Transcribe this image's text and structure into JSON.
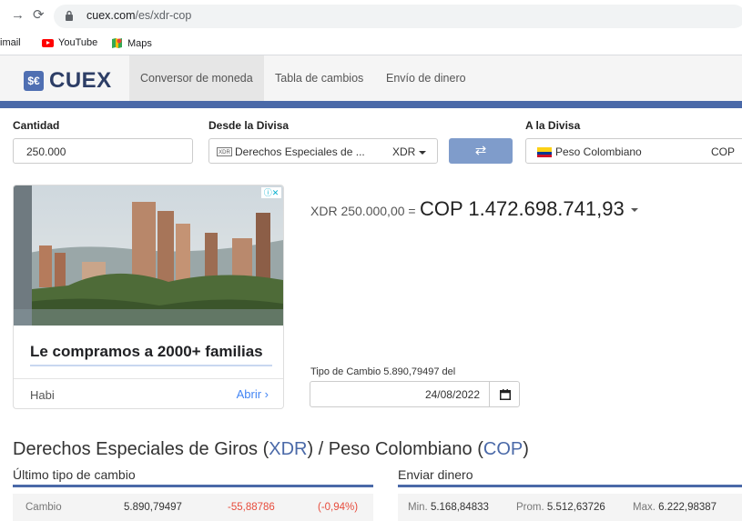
{
  "browser": {
    "url_host": "cuex.com",
    "url_path": "/es/xdr-cop",
    "bookmarks": [
      {
        "label": "imail"
      },
      {
        "label": "YouTube",
        "icon": "youtube-icon"
      },
      {
        "label": "Maps",
        "icon": "maps-icon"
      }
    ]
  },
  "site": {
    "logo_text": "CUEX",
    "logo_badge": "$€",
    "tabs": [
      "Conversor de moneda",
      "Tabla de cambios",
      "Envío de dinero"
    ]
  },
  "converter": {
    "amount_label": "Cantidad",
    "amount_value": "250.000",
    "from_label": "Desde la Divisa",
    "from_icon_text": "XDR",
    "from_name": "Derechos Especiales de ...",
    "from_code": "XDR",
    "swap_symbol": "⇄",
    "to_label": "A la Divisa",
    "to_name": "Peso Colombiano",
    "to_code": "COP"
  },
  "ad": {
    "adchoices": "ⓘ✕",
    "headline": "Le compramos a 2000+ familias",
    "brand": "Habi",
    "cta": "Abrir ›"
  },
  "result": {
    "from_text": "XDR 250.000,00 =",
    "to_text": "COP 1.472.698.741,93"
  },
  "rate": {
    "label": "Tipo de Cambio 5.890,79497 del",
    "date": "24/08/2022"
  },
  "pair_title": {
    "part1": "Derechos Especiales de Giros (",
    "code1": "XDR",
    "part2": ") / Peso Colombiano (",
    "code2": "COP",
    "part3": ")"
  },
  "latest": {
    "heading": "Último tipo de cambio",
    "label": "Cambio",
    "value": "5.890,79497",
    "change": "-55,88786",
    "change_pct": "(-0,94%)"
  },
  "send": {
    "heading": "Enviar dinero",
    "min_label": "Min.",
    "min_value": "5.168,84833",
    "avg_label": "Prom.",
    "avg_value": "5.512,63726",
    "max_label": "Max.",
    "max_value": "6.222,98387"
  },
  "colors": {
    "brand": "#4a69a8",
    "swap": "#7f9ccb",
    "negative": "#e74c3c",
    "link": "#4285f4"
  }
}
